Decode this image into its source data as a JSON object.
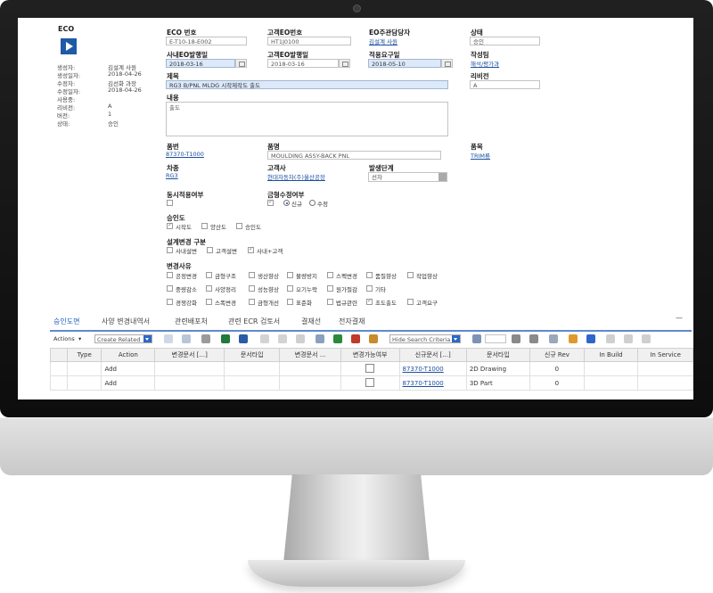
{
  "form": {
    "eco_title": "ECO",
    "meta": [
      {
        "label": "생성자:",
        "value": "김설계 사원"
      },
      {
        "label": "생성일자:",
        "value": "2018-04-26"
      },
      {
        "label": "수정자:",
        "value": "김선화 과장"
      },
      {
        "label": "수정일자:",
        "value": "2018-04-26"
      },
      {
        "label": "사용중:",
        "value": ""
      },
      {
        "label": "리비전:",
        "value": "A"
      },
      {
        "label": "버전:",
        "value": "1"
      },
      {
        "label": "상태:",
        "value": "승인"
      }
    ],
    "eco_no_label": "ECO 번호",
    "eco_no": "E-T10-18-E002",
    "cust_eo_no_label": "고객EO번호",
    "cust_eo_no": "HT1J0100",
    "eo_manager_label": "EO주관담당자",
    "eo_manager": "김설계 사원",
    "status_label": "상태",
    "status": "승인",
    "internal_eo_date_label": "사내EO발행일",
    "internal_eo_date": "2018-03-16",
    "cust_eo_date_label": "고객EO발행일",
    "cust_eo_date": "2018-03-16",
    "apply_date_label": "적용요구일",
    "apply_date": "2018-05-10",
    "author_label": "작성팀",
    "author": "해석/평가과",
    "title_label": "제목",
    "title": "RG3 B/PNL MLDG 시작제작도 출도",
    "revision_label": "리비전",
    "revision": "A",
    "content_label": "내용",
    "content": "출도",
    "part_no_label": "품번",
    "part_no": "87370-T1000",
    "part_name_label": "품명",
    "part_name": "MOULDING ASSY-BACK PNL",
    "item_label": "품목",
    "item": "TRIM류",
    "car_label": "차종",
    "car": "RG3",
    "customer_label": "고객사",
    "customer": "현대자동차(주)울산공장",
    "stage_label": "발생단계",
    "stage": "선차",
    "simultaneous_label": "동시적용여부",
    "mold_label": "금형수정여부",
    "mold_options": [
      "신규",
      "수정"
    ],
    "approval_label": "승인도",
    "approval_options": [
      "시작도",
      "양산도",
      "승인도"
    ],
    "design_change_label": "설계변경 구분",
    "design_change_options": [
      "사내설변",
      "고객설변",
      "사내+고객"
    ],
    "reason_label": "변경사유",
    "reasons": [
      [
        "공정변경",
        "금형구조",
        "생산향상",
        "불량방지",
        "스펙변경",
        "품질향상",
        "작업향상"
      ],
      [
        "중량감소",
        "사양정리",
        "성능향상",
        "오기누락",
        "원가절감",
        "기타"
      ],
      [
        "경쟁강화",
        "스폭변경",
        "금형개선",
        "표준화",
        "법규관련",
        "초도출도",
        "고객요구"
      ]
    ]
  },
  "tabs": [
    "승인도면",
    "사양 변경내역서",
    "관련배포처",
    "관련 ECR 검토서",
    "결재선",
    "전자결재"
  ],
  "toolbar": {
    "actions": "Actions",
    "create_related": "Create Related",
    "hide_search": "Hide Search Criteria"
  },
  "grid": {
    "headers": [
      "",
      "Type",
      "Action",
      "변경문서 [...]",
      "문서타입",
      "변경문서 ...",
      "변경가능여부",
      "신규문서 [...]",
      "문서타입",
      "신규 Rev",
      "In Build",
      "In Service"
    ],
    "rows": [
      [
        "",
        "",
        "Add",
        "",
        "",
        "",
        "",
        "87370-T1000",
        "2D Drawing",
        "0",
        "",
        ""
      ],
      [
        "",
        "",
        "Add",
        "",
        "",
        "",
        "",
        "87370-T1000",
        "3D Part",
        "0",
        "",
        ""
      ]
    ]
  }
}
